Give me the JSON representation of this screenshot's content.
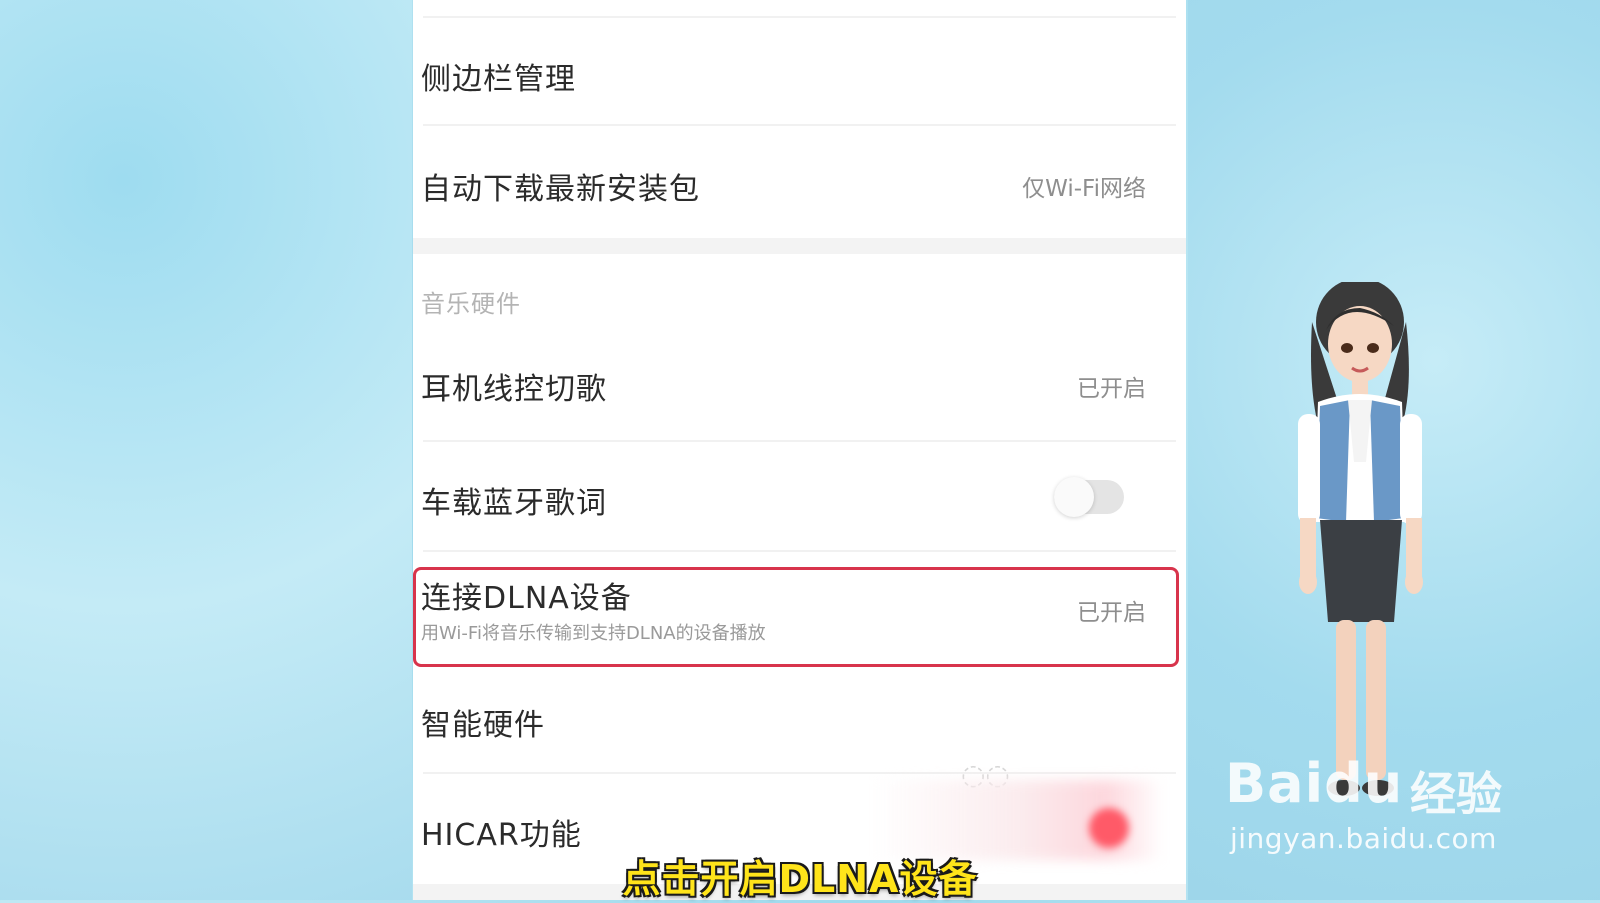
{
  "settings": {
    "sidebar_manage": "侧边栏管理",
    "auto_download": "自动下载最新安装包",
    "auto_download_value": "仅Wi-Fi网络",
    "section_music_hardware": "音乐硬件",
    "headset_control": "耳机线控切歌",
    "headset_control_value": "已开启",
    "car_bluetooth_lyrics": "车载蓝牙歌词",
    "car_bluetooth_lyrics_on": false,
    "dlna": "连接DLNA设备",
    "dlna_desc": "用Wi-Fi将音乐传输到支持DLNA的设备播放",
    "dlna_value": "已开启",
    "smart_hardware": "智能硬件",
    "hicar": "HICAR功能"
  },
  "caption": "点击开启DLNA设备",
  "watermark": {
    "logo": "Baidu",
    "cn": "经验",
    "url": "jingyan.baidu.com"
  },
  "colors": {
    "highlight": "#d8344c",
    "caption": "#ffe41a"
  }
}
